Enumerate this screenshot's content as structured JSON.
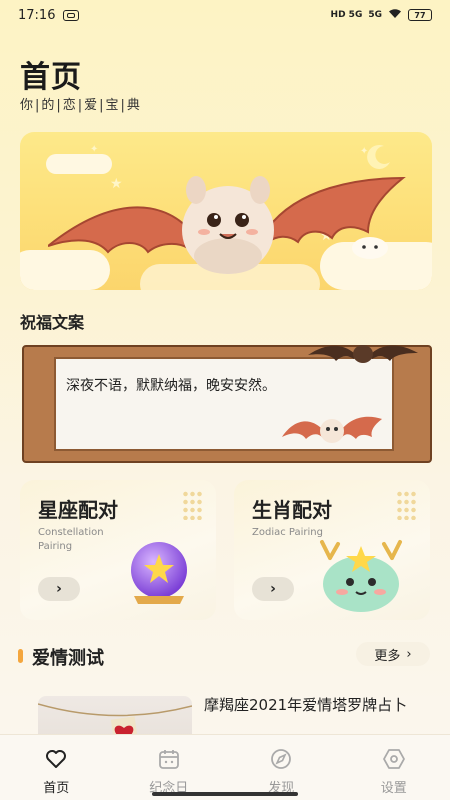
{
  "status_bar": {
    "time": "17:16",
    "network_1": "HD 5G",
    "network_2": "5G",
    "battery": "77"
  },
  "header": {
    "title": "首页",
    "subtitle": "你|的|恋|爱|宝|典"
  },
  "banner": {
    "image": "bat-mascot-illustration"
  },
  "blessing": {
    "section_title": "祝福文案",
    "text": "深夜不语，默默纳福，晚安安然。"
  },
  "cards": [
    {
      "title": "星座配对",
      "subtitle": "Constellation Pairing",
      "arrow": "›",
      "icon": "crystal-ball-star-icon"
    },
    {
      "title": "生肖配对",
      "subtitle": "Zodiac Pairing",
      "arrow": "›",
      "icon": "dragon-mascot-icon"
    }
  ],
  "love_test": {
    "section_title": "爱情测试",
    "more_label": "更多",
    "article_title": "摩羯座2021年爱情塔罗牌占卜"
  },
  "tabs": [
    {
      "label": "首页",
      "icon": "heart-icon",
      "active": true
    },
    {
      "label": "纪念日",
      "icon": "calendar-icon",
      "active": false
    },
    {
      "label": "发现",
      "icon": "compass-icon",
      "active": false
    },
    {
      "label": "设置",
      "icon": "settings-icon",
      "active": false
    }
  ],
  "colors": {
    "accent": "#f4a63d",
    "banner": "#fde07a",
    "frame": "#b77b4c"
  }
}
